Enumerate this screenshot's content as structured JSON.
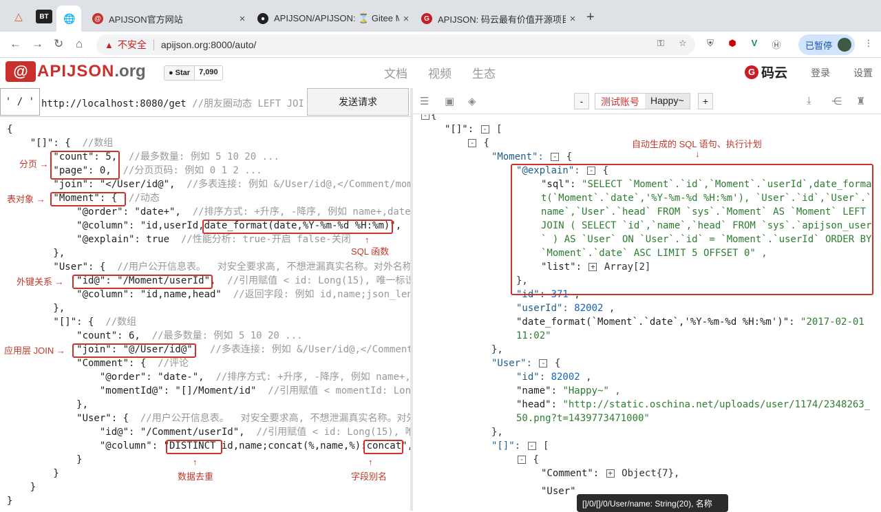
{
  "browser": {
    "pinned_tabs": [
      "△",
      "BT",
      "🌐"
    ],
    "tabs": [
      {
        "title": "APIJSON官方网站",
        "active": true
      },
      {
        "title": "APIJSON/APIJSON: ⌛ Gitee M",
        "active": false
      },
      {
        "title": "APIJSON: 码云最有价值开源项目",
        "active": false
      }
    ],
    "security": "不安全",
    "url": "apijson.org:8000/auto/",
    "paused_label": "已暂停"
  },
  "site": {
    "logo_box": "@",
    "logo_name": "APIJSON",
    "logo_suffix": ".org",
    "github_star": "Star",
    "github_count": "7,090",
    "nav": [
      "文档",
      "视频",
      "生态"
    ],
    "gitee": "码云",
    "login": "登录",
    "settings": "设置"
  },
  "request": {
    "method": "' / '",
    "url": "http://localhost:8080/get",
    "url_comment": "  //朋友圈动态 LEFT JOI",
    "send_label": "发送请求"
  },
  "left_code": [
    {
      "t": "{",
      "c": ""
    },
    {
      "t": "    \"[]\": {  ",
      "c": "//数组"
    },
    {
      "t": "        \"count\": 5,  ",
      "c": "//最多数量: 例如 5 10 20 ..."
    },
    {
      "t": "        \"page\": 0,  ",
      "c": "//分页页码: 例如 0 1 2 ..."
    },
    {
      "t": "        \"join\": \"</User/id@\",  ",
      "c": "//多表连接: 例如 &/User/id@,</Comment/mom"
    },
    {
      "t": "        \"Moment\": {  ",
      "c": "//动态"
    },
    {
      "t": "            \"@order\": \"date+\",  ",
      "c": "//排序方式: +升序, -降序, 例如 name+,date-"
    },
    {
      "t": "            \"@column\": \"id,userId,date_format(date,%Y-%m-%d %H:%m)\",",
      "c": ""
    },
    {
      "t": "            \"@explain\": true  ",
      "c": "//性能分析: true-开启 false-关闭"
    },
    {
      "t": "        },",
      "c": ""
    },
    {
      "t": "        \"User\": {  ",
      "c": "//用户公开信息表。  对安全要求高, 不想泄漏真实名称。对外名称"
    },
    {
      "t": "            \"id@\": \"/Moment/userId\",  ",
      "c": "//引用赋值 < id: Long(15), 唯一标识"
    },
    {
      "t": "            \"@column\": \"id,name,head\"  ",
      "c": "//返回字段: 例如 id,name;json_len"
    },
    {
      "t": "        },",
      "c": ""
    },
    {
      "t": "        \"[]\": {  ",
      "c": "//数组"
    },
    {
      "t": "            \"count\": 6,  ",
      "c": "//最多数量: 例如 5 10 20 ..."
    },
    {
      "t": "            \"join\": \"@/User/id@\",  ",
      "c": "//多表连接: 例如 &/User/id@,</Comment"
    },
    {
      "t": "            \"Comment\": {  ",
      "c": "//评论"
    },
    {
      "t": "                \"@order\": \"date-\",  ",
      "c": "//排序方式: +升序, -降序, 例如 name+,c"
    },
    {
      "t": "                \"momentId@\": \"[]/Moment/id\"  ",
      "c": "//引用赋值 < momentId: Lon"
    },
    {
      "t": "            },",
      "c": ""
    },
    {
      "t": "            \"User\": {  ",
      "c": "//用户公开信息表。  对安全要求高, 不想泄漏真实名称。对外"
    },
    {
      "t": "                \"id@\": \"/Comment/userId\",  ",
      "c": "//引用赋值 < id: Long(15), 唯"
    },
    {
      "t": "                \"@column\": \"DISTINCT id,name;concat(%,name,%):concat\",",
      "c": ""
    },
    {
      "t": "            }",
      "c": ""
    },
    {
      "t": "        }",
      "c": ""
    },
    {
      "t": "    }",
      "c": ""
    },
    {
      "t": "}",
      "c": ""
    }
  ],
  "annotations": {
    "paging": "分页",
    "table_object": "表对象",
    "sql_function": "SQL 函数",
    "foreign_key": "外键关系",
    "app_join": "应用层 JOIN",
    "dedupe": "数据去重",
    "alias": "字段别名",
    "auto_sql": "自动生成的 SQL 语句、执行计划"
  },
  "right_toolbar": {
    "minus": "-",
    "account": "测试账号",
    "user": "Happy~",
    "plus": "+"
  },
  "right_code": {
    "l1": "{",
    "l2_key": "\"[]\":",
    "l2_rest": " [",
    "l3": "{",
    "moment_key": "\"Moment\":",
    "brace": " {",
    "explain_key": "\"@explain\":",
    "sql_key": "\"sql\": ",
    "sql_lines": [
      "\"SELECT `Moment`.`id`,`Moment`.`userId`,date_forma",
      "t(`Moment`.`date`,'%Y-%m-%d %H:%m'), `User`.`id`,`User`.`",
      "name`,`User`.`head` FROM `sys`.`Moment` AS `Moment` LEFT",
      "JOIN ( SELECT `id`,`name`,`head` FROM `sys`.`apijson_user",
      "` ) AS `User` ON `User`.`id` = `Moment`.`userId` ORDER BY",
      "`Moment`.`date` ASC LIMIT 5 OFFSET 0\" ,"
    ],
    "list_key": "\"list\":",
    "list_val": "Array[2]",
    "close_obj": "},",
    "id_key": "\"id\": ",
    "id_val": "371",
    "userid_key": "\"userId\": ",
    "userid_val": "82002",
    "datefmt_key": "\"date_format(`Moment`.`date`,'%Y-%m-%d %H:%m')\": ",
    "datefmt_val": "\"2017-02-01",
    "datefmt_val2": "11:02\"",
    "close_moment": "},",
    "user_key": "\"User\":",
    "uid_key": "\"id\": ",
    "uid_val": "82002",
    "name_key": "\"name\": ",
    "name_val": "\"Happy~\" ,",
    "head_key": "\"head\": ",
    "head_val": "\"http://static.oschina.net/uploads/user/1174/2348263_",
    "head_val2": "50.png?t=1439773471000\"",
    "close_user": "},",
    "arr_key": "\"[]\":",
    "arr_rest": " [",
    "arr_open": "{",
    "comment_key": "\"Comment\":",
    "comment_val": "Object{7},",
    "user2_key": "\"User\""
  },
  "tooltip": "[]/0/[]/0/User/name: String(20), 名称"
}
